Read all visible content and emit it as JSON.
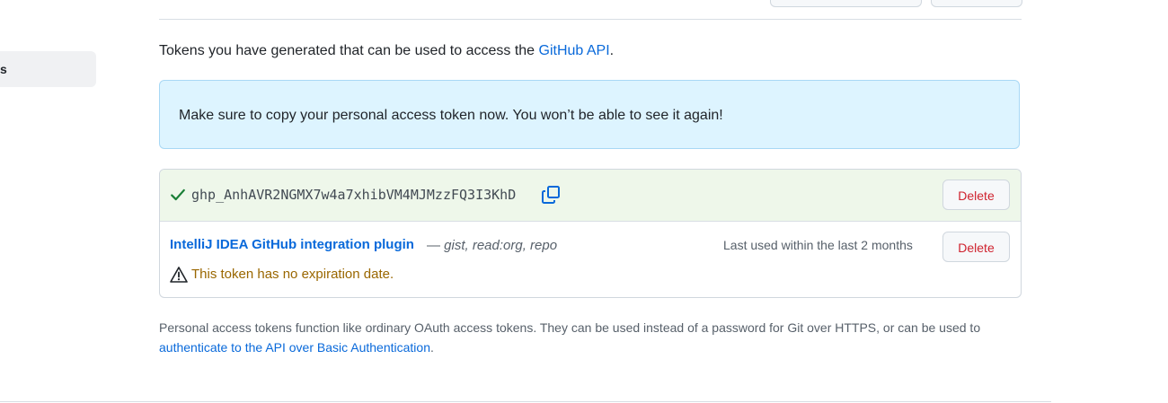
{
  "sidebar": {
    "active_item_label": "s"
  },
  "intro": {
    "text": "Tokens you have generated that can be used to access the ",
    "link_text": "GitHub API",
    "suffix": "."
  },
  "flash": {
    "message": "Make sure to copy your personal access token now. You won’t be able to see it again!"
  },
  "new_token": {
    "value": "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",
    "delete_label": "Delete",
    "icons": {
      "status": "check-icon",
      "copy": "copy-icon"
    }
  },
  "tokens": [
    {
      "name": "IntelliJ IDEA GitHub integration plugin",
      "separator": " — ",
      "scopes": "gist, read:org, repo",
      "last_used": "Last used within the last 2 months",
      "warning": "This token has no expiration date.",
      "delete_label": "Delete"
    }
  ],
  "footnote": {
    "text": "Personal access tokens function like ordinary OAuth access tokens. They can be used instead of a password for Git over HTTPS, or can be used to ",
    "link_text": "authenticate to the API over Basic Authentication",
    "suffix": "."
  },
  "colors": {
    "link": "#0969da",
    "danger": "#cf222e",
    "success": "#1a7f37",
    "warning": "#9a6700",
    "flash_bg": "#ddf4ff",
    "token_new_bg": "#eef7ea"
  }
}
